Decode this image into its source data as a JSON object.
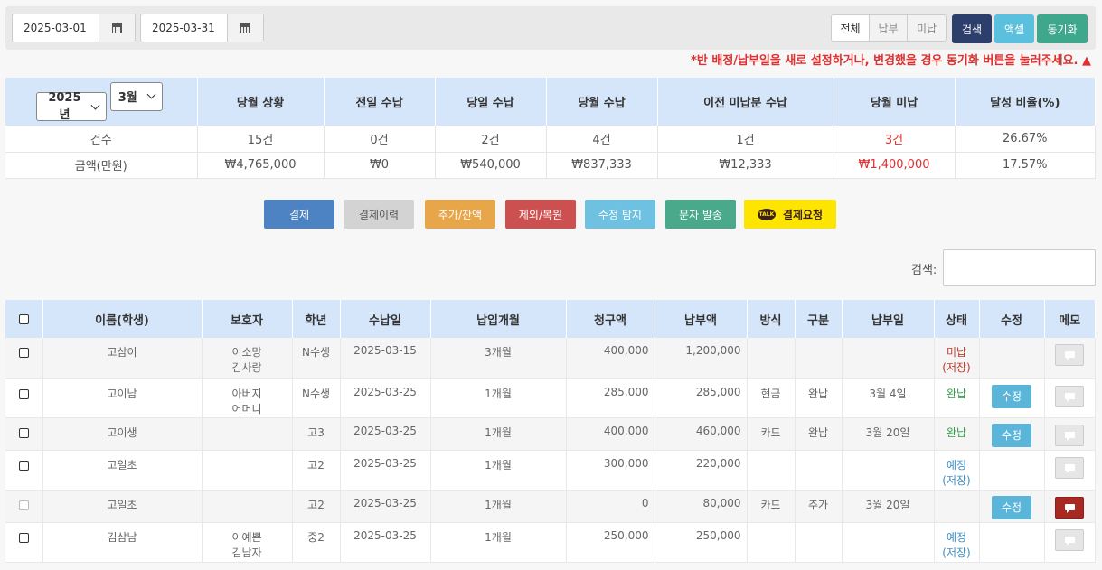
{
  "filters": {
    "start_date": "2025-03-01",
    "end_date": "2025-03-31",
    "segments": [
      "전체",
      "납부",
      "미납"
    ],
    "search_label": "검색",
    "excel_label": "액셀",
    "sync_label": "동기화"
  },
  "notice": "*반 배정/납부일을 새로 설정하거나, 변경했을 경우 동기화 버튼을 눌러주세요. ▲",
  "summary": {
    "year": "2025년",
    "month": "3월",
    "headers": [
      "당월 상황",
      "전일 수납",
      "당일 수납",
      "당월 수납",
      "이전 미납분 수납",
      "당월 미납",
      "달성 비율(%)"
    ],
    "rows": [
      {
        "label": "건수",
        "values": [
          "15건",
          "0건",
          "2건",
          "4건",
          "1건",
          "3건",
          "26.67%"
        ]
      },
      {
        "label": "금액(만원)",
        "values": [
          "₩4,765,000",
          "₩0",
          "₩540,000",
          "₩837,333",
          "₩12,333",
          "₩1,400,000",
          "17.57%"
        ]
      }
    ]
  },
  "actions": {
    "pay": "결제",
    "history": "결제이력",
    "add": "추가/잔액",
    "exclude": "제외/복원",
    "edit_scan": "수정 탐지",
    "sms": "문자 발송",
    "talk_badge": "TALK",
    "request": "결제요청"
  },
  "search": {
    "label": "검색:",
    "placeholder": ""
  },
  "table": {
    "headers": [
      "이름(학생)",
      "보호자",
      "학년",
      "수납일",
      "납입개월",
      "청구액",
      "납부액",
      "방식",
      "구분",
      "납부일",
      "상태",
      "수정",
      "메모"
    ],
    "rows": [
      {
        "name": "고삼이",
        "guardian1": "이소망",
        "guardian2": "김사랑",
        "grade": "N수생",
        "date": "2025-03-15",
        "months": "3개월",
        "billed": "400,000",
        "paid": "1,200,000",
        "method": "",
        "type": "",
        "paydate": "",
        "status1": "미납",
        "status2": "(저장)",
        "edit": "",
        "memo_active": false
      },
      {
        "name": "고이남",
        "guardian1": "아버지",
        "guardian2": "어머니",
        "grade": "N수생",
        "date": "2025-03-25",
        "months": "1개월",
        "billed": "285,000",
        "paid": "285,000",
        "method": "현금",
        "type": "완납",
        "paydate": "3월 4일",
        "status1": "완납",
        "status2": "",
        "edit": "수정",
        "memo_active": false
      },
      {
        "name": "고이생",
        "guardian1": "",
        "guardian2": "",
        "grade": "고3",
        "date": "2025-03-25",
        "months": "1개월",
        "billed": "400,000",
        "paid": "460,000",
        "method": "카드",
        "type": "완납",
        "paydate": "3월 20일",
        "status1": "완납",
        "status2": "",
        "edit": "수정",
        "memo_active": false
      },
      {
        "name": "고일초",
        "guardian1": "",
        "guardian2": "",
        "grade": "고2",
        "date": "2025-03-25",
        "months": "1개월",
        "billed": "300,000",
        "paid": "220,000",
        "method": "",
        "type": "",
        "paydate": "",
        "status1": "예정",
        "status2": "(저장)",
        "edit": "",
        "memo_active": false
      },
      {
        "name": "고일초",
        "guardian1": "",
        "guardian2": "",
        "grade": "고2",
        "date": "2025-03-25",
        "months": "1개월",
        "billed": "0",
        "paid": "80,000",
        "method": "카드",
        "type": "추가",
        "paydate": "3월 20일",
        "status1": "",
        "status2": "",
        "edit": "수정",
        "memo_active": true
      },
      {
        "name": "김삼남",
        "guardian1": "이예쁜",
        "guardian2": "김남자",
        "grade": "중2",
        "date": "2025-03-25",
        "months": "1개월",
        "billed": "250,000",
        "paid": "250,000",
        "method": "",
        "type": "",
        "paydate": "",
        "status1": "예정",
        "status2": "(저장)",
        "edit": "",
        "memo_active": false
      }
    ]
  },
  "colors": {
    "search_btn": "#2c3e6b",
    "excel_btn": "#5bc0de",
    "sync_btn": "#3fa88c",
    "pay_btn": "#4d82c3",
    "history_btn": "#d3d3d3",
    "add_btn": "#e8a64b",
    "exclude_btn": "#cd5050",
    "edit_scan_btn": "#6ec1e0",
    "sms_btn": "#4aa98b",
    "request_btn": "#fde500",
    "header_bg": "#d5e6fb",
    "alert_red": "#e03030"
  }
}
